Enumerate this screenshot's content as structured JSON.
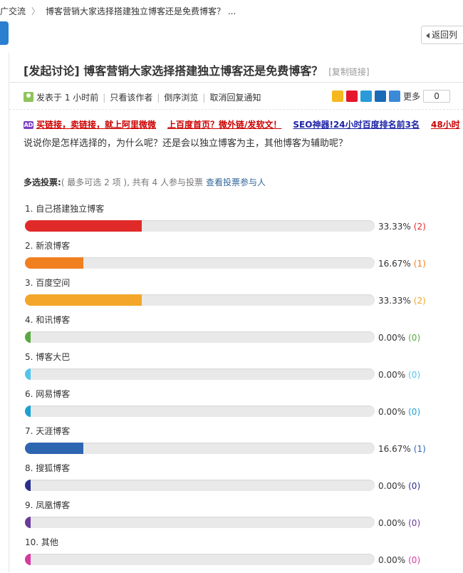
{
  "breadcrumb": {
    "section": "推广交流",
    "page": "博客营销大家选择搭建独立博客还是免费博客？ ..."
  },
  "back_button": {
    "label": "返回列"
  },
  "thread": {
    "title": "[发起讨论] 博客营销大家选择搭建独立博客还是免费博客？",
    "copy_link": "[复制链接]",
    "posted": "发表于 1 小时前",
    "author_only": "只看该作者",
    "reverse": "倒序浏览",
    "notify": "取消回复通知",
    "more": "更多",
    "share_count": "0"
  },
  "ads": [
    {
      "text": "买链接，卖链接，就上阿里微微",
      "color": "#cc0000"
    },
    {
      "text": "上百度首页？微外链/发软文！",
      "color": "#cc0000"
    },
    {
      "text": "SEO神器!24小时百度排名前3名",
      "color": "#1d23a6"
    },
    {
      "text": "48小时",
      "color": "#cc0000"
    }
  ],
  "question": "说说你是怎样选择的，为什么呢？还是会以独立博客为主，其他博客为辅助呢？",
  "poll": {
    "type_label": "多选投票:",
    "info": "( 最多可选 2 项 ), 共有 4 人参与投票",
    "voters_link": "查看投票参与人",
    "options": [
      {
        "label": "1.  自己搭建独立博客",
        "percent": 33.33,
        "pct_text": "33.33%",
        "count_text": "(2)",
        "color": "#e02a2a"
      },
      {
        "label": "2.  新浪博客",
        "percent": 16.67,
        "pct_text": "16.67%",
        "count_text": "(1)",
        "color": "#f07f20"
      },
      {
        "label": "3.  百度空间",
        "percent": 33.33,
        "pct_text": "33.33%",
        "count_text": "(2)",
        "color": "#f3a629"
      },
      {
        "label": "4.  和讯博客",
        "percent": 0,
        "pct_text": "0.00%",
        "count_text": "(0)",
        "color": "#5aa843"
      },
      {
        "label": "5.  博客大巴",
        "percent": 0,
        "pct_text": "0.00%",
        "count_text": "(0)",
        "color": "#55c4ec"
      },
      {
        "label": "6.  网易博客",
        "percent": 0,
        "pct_text": "0.00%",
        "count_text": "(0)",
        "color": "#1ba1d1"
      },
      {
        "label": "7.  天涯博客",
        "percent": 16.67,
        "pct_text": "16.67%",
        "count_text": "(1)",
        "color": "#2e65b1"
      },
      {
        "label": "8.  搜狐博客",
        "percent": 0,
        "pct_text": "0.00%",
        "count_text": "(0)",
        "color": "#2a2f8c"
      },
      {
        "label": "9.  凤凰博客",
        "percent": 0,
        "pct_text": "0.00%",
        "count_text": "(0)",
        "color": "#6a3a9c"
      },
      {
        "label": "10.  其他",
        "percent": 0,
        "pct_text": "0.00%",
        "count_text": "(0)",
        "color": "#d63aa0"
      }
    ]
  },
  "share_icons": [
    {
      "name": "qzone-icon",
      "color": "#f5b81f"
    },
    {
      "name": "weibo-icon",
      "color": "#e6162d"
    },
    {
      "name": "pengyou-icon",
      "color": "#2a9ad9"
    },
    {
      "name": "renren-icon",
      "color": "#1b6ab6"
    },
    {
      "name": "add-share-icon",
      "color": "#3b8ad8"
    }
  ]
}
